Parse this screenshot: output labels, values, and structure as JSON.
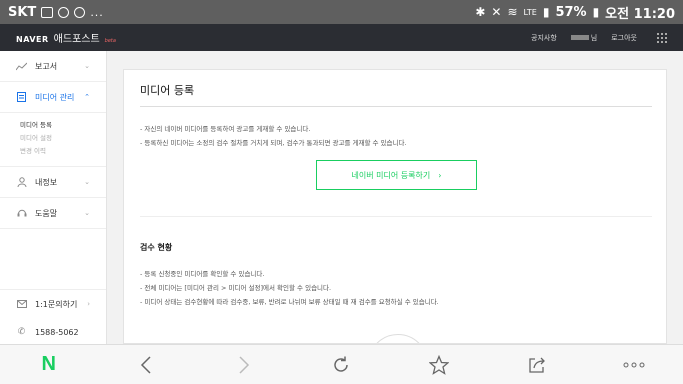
{
  "statusbar": {
    "carrier": "SKT",
    "dots": "...",
    "network": "LTE",
    "battery": "57%",
    "time": "오전 11:20"
  },
  "header": {
    "logo_naver": "NAVER",
    "logo_service": "애드포스트",
    "logo_beta": "beta",
    "nav": {
      "notice": "공지사항",
      "user_suffix": "님",
      "logout": "로그아웃"
    }
  },
  "sidebar": {
    "items": [
      {
        "label": "보고서",
        "icon": "chart-icon"
      },
      {
        "label": "미디어 관리",
        "icon": "document-icon"
      },
      {
        "label": "내정보",
        "icon": "user-icon"
      },
      {
        "label": "도움말",
        "icon": "headset-icon"
      }
    ],
    "sub_items": [
      "미디어 등록",
      "미디어 설정",
      "변경 이력"
    ],
    "bottom": {
      "inquiry": "1:1문의하기",
      "phone": "1588-5062"
    }
  },
  "main": {
    "title": "미디어 등록",
    "desc1": "- 자신의 네이버 미디어를 등록하여 광고를 게재할 수 있습니다.",
    "desc2": "- 등록하신 미디어는 소정의 검수 절차를 거치게 되며, 검수가 통과되면 광고를 게재할 수 있습니다.",
    "register_button": "네이버 미디어 등록하기",
    "review_title": "검수 현황",
    "review1": "- 등록 신청중인 미디어를 확인할 수 있습니다.",
    "review2": "- 전체 미디어는 [미디어 관리 > 미디어 설정]에서 확인할 수 있습니다.",
    "review3": "- 미디어 상태는 검수현황에 따라 검수중, 보류, 반려로 나뉘며 보류 상태일 때 재 검수를 요청하실 수 있습니다."
  },
  "colors": {
    "accent": "#19ce60",
    "active": "#1a73e8",
    "topbar": "#2b2d33"
  }
}
